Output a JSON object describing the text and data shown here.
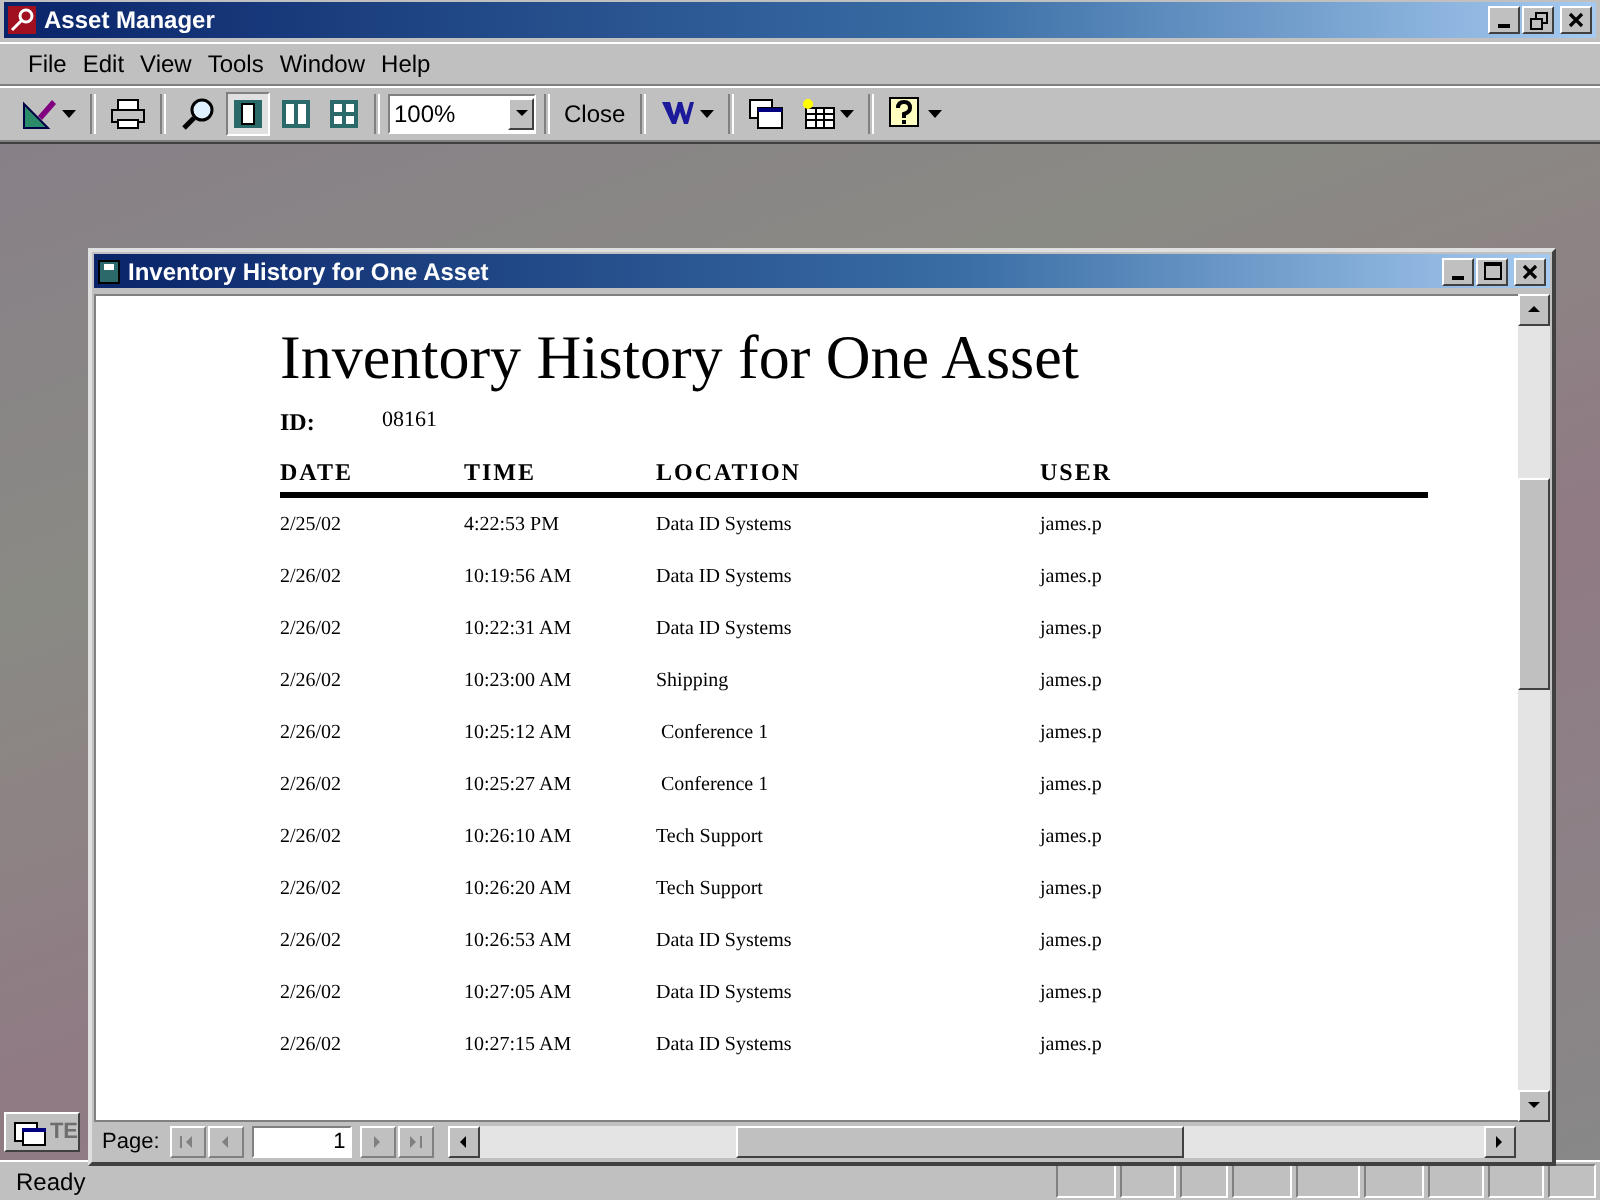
{
  "window": {
    "title": "Asset Manager"
  },
  "menu": [
    "File",
    "Edit",
    "View",
    "Tools",
    "Window",
    "Help"
  ],
  "toolbar": [
    {
      "kind": "view-design",
      "dropdown": true
    },
    {
      "kind": "print"
    },
    {
      "kind": "zoom"
    },
    {
      "kind": "one-page",
      "selected": true
    },
    {
      "kind": "two-pages",
      "selected": false
    },
    {
      "kind": "multiple-pages",
      "selected": false
    },
    {
      "kind": "zoom-box",
      "value": "100%"
    },
    {
      "kind": "close",
      "label": "Close"
    },
    {
      "kind": "word",
      "dropdown": true
    },
    {
      "kind": "database-window"
    },
    {
      "kind": "new-object",
      "dropdown": true
    },
    {
      "kind": "help",
      "dropdown": true
    }
  ],
  "child_window": {
    "title": "Inventory History for One Asset"
  },
  "report": {
    "title": "Inventory History for One Asset",
    "id_label": "ID:",
    "id_value": "08161",
    "columns": [
      "DATE",
      "TIME",
      "LOCATION",
      "USER"
    ],
    "rows": [
      [
        "2/25/02",
        "4:22:53 PM",
        "Data ID Systems",
        "james.p"
      ],
      [
        "2/26/02",
        "10:19:56 AM",
        "Data ID Systems",
        "james.p"
      ],
      [
        "2/26/02",
        "10:22:31 AM",
        "Data ID Systems",
        "james.p"
      ],
      [
        "2/26/02",
        "10:23:00 AM",
        "Shipping",
        "james.p"
      ],
      [
        "2/26/02",
        "10:25:12 AM",
        " Conference 1",
        "james.p"
      ],
      [
        "2/26/02",
        "10:25:27 AM",
        " Conference 1",
        "james.p"
      ],
      [
        "2/26/02",
        "10:26:10 AM",
        "Tech Support",
        "james.p"
      ],
      [
        "2/26/02",
        "10:26:20 AM",
        "Tech Support",
        "james.p"
      ],
      [
        "2/26/02",
        "10:26:53 AM",
        "Data ID Systems",
        "james.p"
      ],
      [
        "2/26/02",
        "10:27:05 AM",
        "Data ID Systems",
        "james.p"
      ],
      [
        "2/26/02",
        "10:27:15 AM",
        "Data ID Systems",
        "james.p"
      ]
    ]
  },
  "navigation": {
    "label": "Page:",
    "page": "1"
  },
  "minimized_window": {
    "label": "TE"
  },
  "status_bar": {
    "text": "Ready"
  }
}
